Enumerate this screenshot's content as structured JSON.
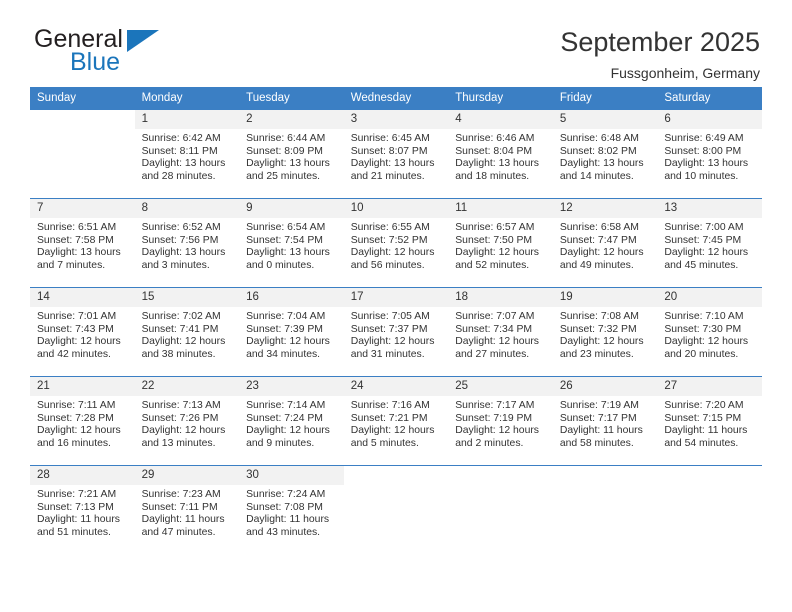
{
  "logo": {
    "word_one": "General",
    "word_two": "Blue",
    "triangle_color": "#1b75bb"
  },
  "header": {
    "title": "September 2025",
    "subtitle": "Fussgonheim, Germany"
  },
  "theme": {
    "header_blue": "#3b7fc4",
    "daynum_background": "#f2f2f2",
    "text": "#333333"
  },
  "weekday_headers": [
    "Sunday",
    "Monday",
    "Tuesday",
    "Wednesday",
    "Thursday",
    "Friday",
    "Saturday"
  ],
  "weeks": [
    [
      {
        "day": "",
        "sunrise": "",
        "sunset": "",
        "daylight_line1": "",
        "daylight_line2": ""
      },
      {
        "day": "1",
        "sunrise": "Sunrise: 6:42 AM",
        "sunset": "Sunset: 8:11 PM",
        "daylight_line1": "Daylight: 13 hours",
        "daylight_line2": "and 28 minutes."
      },
      {
        "day": "2",
        "sunrise": "Sunrise: 6:44 AM",
        "sunset": "Sunset: 8:09 PM",
        "daylight_line1": "Daylight: 13 hours",
        "daylight_line2": "and 25 minutes."
      },
      {
        "day": "3",
        "sunrise": "Sunrise: 6:45 AM",
        "sunset": "Sunset: 8:07 PM",
        "daylight_line1": "Daylight: 13 hours",
        "daylight_line2": "and 21 minutes."
      },
      {
        "day": "4",
        "sunrise": "Sunrise: 6:46 AM",
        "sunset": "Sunset: 8:04 PM",
        "daylight_line1": "Daylight: 13 hours",
        "daylight_line2": "and 18 minutes."
      },
      {
        "day": "5",
        "sunrise": "Sunrise: 6:48 AM",
        "sunset": "Sunset: 8:02 PM",
        "daylight_line1": "Daylight: 13 hours",
        "daylight_line2": "and 14 minutes."
      },
      {
        "day": "6",
        "sunrise": "Sunrise: 6:49 AM",
        "sunset": "Sunset: 8:00 PM",
        "daylight_line1": "Daylight: 13 hours",
        "daylight_line2": "and 10 minutes."
      }
    ],
    [
      {
        "day": "7",
        "sunrise": "Sunrise: 6:51 AM",
        "sunset": "Sunset: 7:58 PM",
        "daylight_line1": "Daylight: 13 hours",
        "daylight_line2": "and 7 minutes."
      },
      {
        "day": "8",
        "sunrise": "Sunrise: 6:52 AM",
        "sunset": "Sunset: 7:56 PM",
        "daylight_line1": "Daylight: 13 hours",
        "daylight_line2": "and 3 minutes."
      },
      {
        "day": "9",
        "sunrise": "Sunrise: 6:54 AM",
        "sunset": "Sunset: 7:54 PM",
        "daylight_line1": "Daylight: 13 hours",
        "daylight_line2": "and 0 minutes."
      },
      {
        "day": "10",
        "sunrise": "Sunrise: 6:55 AM",
        "sunset": "Sunset: 7:52 PM",
        "daylight_line1": "Daylight: 12 hours",
        "daylight_line2": "and 56 minutes."
      },
      {
        "day": "11",
        "sunrise": "Sunrise: 6:57 AM",
        "sunset": "Sunset: 7:50 PM",
        "daylight_line1": "Daylight: 12 hours",
        "daylight_line2": "and 52 minutes."
      },
      {
        "day": "12",
        "sunrise": "Sunrise: 6:58 AM",
        "sunset": "Sunset: 7:47 PM",
        "daylight_line1": "Daylight: 12 hours",
        "daylight_line2": "and 49 minutes."
      },
      {
        "day": "13",
        "sunrise": "Sunrise: 7:00 AM",
        "sunset": "Sunset: 7:45 PM",
        "daylight_line1": "Daylight: 12 hours",
        "daylight_line2": "and 45 minutes."
      }
    ],
    [
      {
        "day": "14",
        "sunrise": "Sunrise: 7:01 AM",
        "sunset": "Sunset: 7:43 PM",
        "daylight_line1": "Daylight: 12 hours",
        "daylight_line2": "and 42 minutes."
      },
      {
        "day": "15",
        "sunrise": "Sunrise: 7:02 AM",
        "sunset": "Sunset: 7:41 PM",
        "daylight_line1": "Daylight: 12 hours",
        "daylight_line2": "and 38 minutes."
      },
      {
        "day": "16",
        "sunrise": "Sunrise: 7:04 AM",
        "sunset": "Sunset: 7:39 PM",
        "daylight_line1": "Daylight: 12 hours",
        "daylight_line2": "and 34 minutes."
      },
      {
        "day": "17",
        "sunrise": "Sunrise: 7:05 AM",
        "sunset": "Sunset: 7:37 PM",
        "daylight_line1": "Daylight: 12 hours",
        "daylight_line2": "and 31 minutes."
      },
      {
        "day": "18",
        "sunrise": "Sunrise: 7:07 AM",
        "sunset": "Sunset: 7:34 PM",
        "daylight_line1": "Daylight: 12 hours",
        "daylight_line2": "and 27 minutes."
      },
      {
        "day": "19",
        "sunrise": "Sunrise: 7:08 AM",
        "sunset": "Sunset: 7:32 PM",
        "daylight_line1": "Daylight: 12 hours",
        "daylight_line2": "and 23 minutes."
      },
      {
        "day": "20",
        "sunrise": "Sunrise: 7:10 AM",
        "sunset": "Sunset: 7:30 PM",
        "daylight_line1": "Daylight: 12 hours",
        "daylight_line2": "and 20 minutes."
      }
    ],
    [
      {
        "day": "21",
        "sunrise": "Sunrise: 7:11 AM",
        "sunset": "Sunset: 7:28 PM",
        "daylight_line1": "Daylight: 12 hours",
        "daylight_line2": "and 16 minutes."
      },
      {
        "day": "22",
        "sunrise": "Sunrise: 7:13 AM",
        "sunset": "Sunset: 7:26 PM",
        "daylight_line1": "Daylight: 12 hours",
        "daylight_line2": "and 13 minutes."
      },
      {
        "day": "23",
        "sunrise": "Sunrise: 7:14 AM",
        "sunset": "Sunset: 7:24 PM",
        "daylight_line1": "Daylight: 12 hours",
        "daylight_line2": "and 9 minutes."
      },
      {
        "day": "24",
        "sunrise": "Sunrise: 7:16 AM",
        "sunset": "Sunset: 7:21 PM",
        "daylight_line1": "Daylight: 12 hours",
        "daylight_line2": "and 5 minutes."
      },
      {
        "day": "25",
        "sunrise": "Sunrise: 7:17 AM",
        "sunset": "Sunset: 7:19 PM",
        "daylight_line1": "Daylight: 12 hours",
        "daylight_line2": "and 2 minutes."
      },
      {
        "day": "26",
        "sunrise": "Sunrise: 7:19 AM",
        "sunset": "Sunset: 7:17 PM",
        "daylight_line1": "Daylight: 11 hours",
        "daylight_line2": "and 58 minutes."
      },
      {
        "day": "27",
        "sunrise": "Sunrise: 7:20 AM",
        "sunset": "Sunset: 7:15 PM",
        "daylight_line1": "Daylight: 11 hours",
        "daylight_line2": "and 54 minutes."
      }
    ],
    [
      {
        "day": "28",
        "sunrise": "Sunrise: 7:21 AM",
        "sunset": "Sunset: 7:13 PM",
        "daylight_line1": "Daylight: 11 hours",
        "daylight_line2": "and 51 minutes."
      },
      {
        "day": "29",
        "sunrise": "Sunrise: 7:23 AM",
        "sunset": "Sunset: 7:11 PM",
        "daylight_line1": "Daylight: 11 hours",
        "daylight_line2": "and 47 minutes."
      },
      {
        "day": "30",
        "sunrise": "Sunrise: 7:24 AM",
        "sunset": "Sunset: 7:08 PM",
        "daylight_line1": "Daylight: 11 hours",
        "daylight_line2": "and 43 minutes."
      },
      {
        "day": "",
        "sunrise": "",
        "sunset": "",
        "daylight_line1": "",
        "daylight_line2": ""
      },
      {
        "day": "",
        "sunrise": "",
        "sunset": "",
        "daylight_line1": "",
        "daylight_line2": ""
      },
      {
        "day": "",
        "sunrise": "",
        "sunset": "",
        "daylight_line1": "",
        "daylight_line2": ""
      },
      {
        "day": "",
        "sunrise": "",
        "sunset": "",
        "daylight_line1": "",
        "daylight_line2": ""
      }
    ]
  ]
}
